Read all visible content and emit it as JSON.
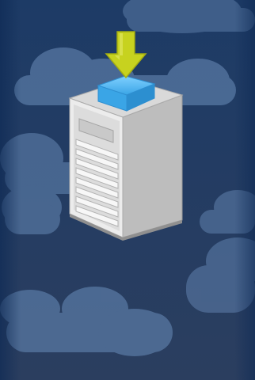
{
  "illustration": {
    "subject": "server-upload",
    "icons": [
      "download-arrow-icon",
      "data-box-icon",
      "server-tower-icon",
      "cloud-icon"
    ],
    "colors": {
      "background_top": "#1d3b66",
      "background_bottom": "#2b3e5f",
      "cloud": "#5b7ca7",
      "arrow": "#c7d21f",
      "box": "#3aa5e6",
      "server_front": "#e6e6e6",
      "server_side": "#bdbdbd"
    }
  }
}
